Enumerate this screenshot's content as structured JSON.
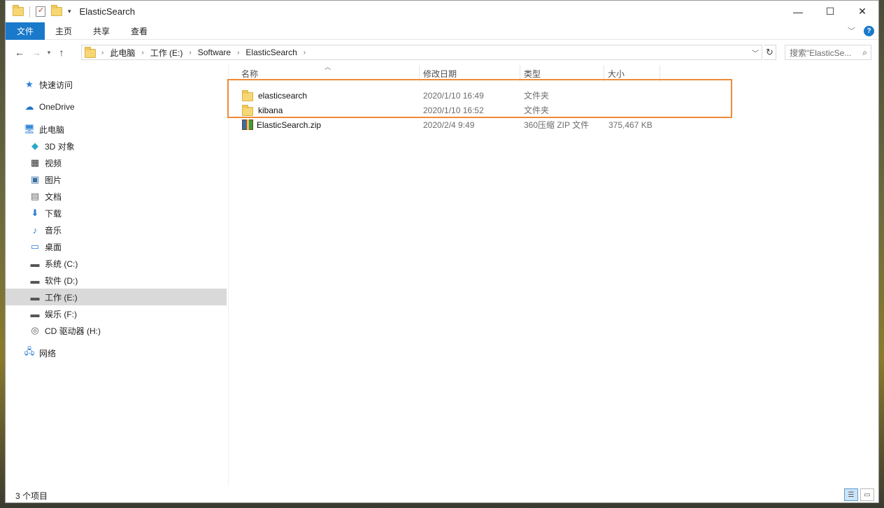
{
  "window": {
    "title": "ElasticSearch"
  },
  "ribbon": {
    "tabs": [
      "文件",
      "主页",
      "共享",
      "查看"
    ]
  },
  "address": {
    "crumbs": [
      "此电脑",
      "工作 (E:)",
      "Software",
      "ElasticSearch"
    ]
  },
  "search": {
    "placeholder": "搜索\"ElasticSe..."
  },
  "nav": {
    "quick_access": "快速访问",
    "onedrive": "OneDrive",
    "this_pc": "此电脑",
    "items": [
      "3D 对象",
      "视频",
      "图片",
      "文档",
      "下载",
      "音乐",
      "桌面",
      "系统 (C:)",
      "软件 (D:)",
      "工作 (E:)",
      "娱乐 (F:)",
      "CD 驱动器 (H:)"
    ],
    "network": "网络"
  },
  "columns": {
    "name": "名称",
    "date": "修改日期",
    "type": "类型",
    "size": "大小"
  },
  "files": [
    {
      "name": "elasticsearch",
      "date": "2020/1/10 16:49",
      "type": "文件夹",
      "size": "",
      "icon": "folder-icon"
    },
    {
      "name": "kibana",
      "date": "2020/1/10 16:52",
      "type": "文件夹",
      "size": "",
      "icon": "folder-icon"
    },
    {
      "name": "ElasticSearch.zip",
      "date": "2020/2/4 9:49",
      "type": "360压缩 ZIP 文件",
      "size": "375,467 KB",
      "icon": "zip-archive-icon"
    }
  ],
  "status": {
    "count": "3 个项目"
  },
  "colors": {
    "file_tab": "#1979ca",
    "highlight_box": "#ef8a3a",
    "selected_nav": "#d9d9d9"
  }
}
